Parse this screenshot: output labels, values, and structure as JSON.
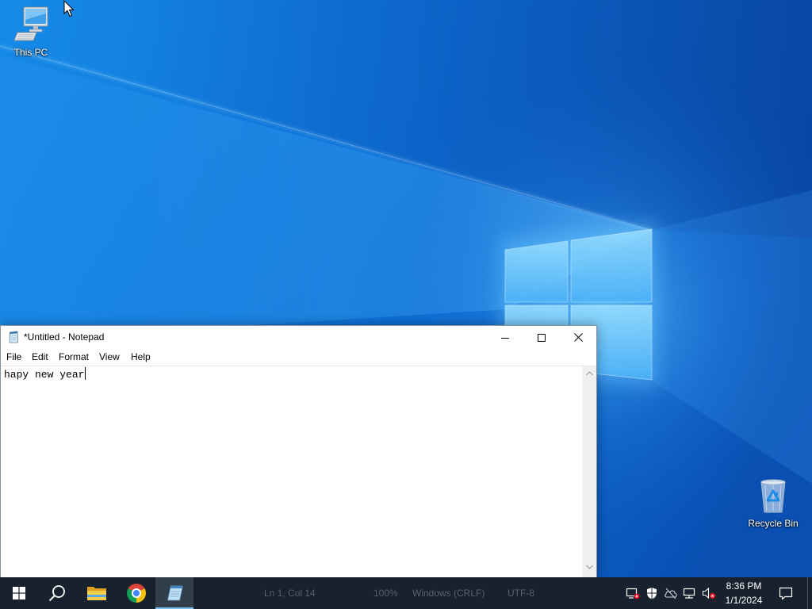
{
  "colors": {
    "desktop_blue": "#0f6fd4",
    "wallpaper_logo": "#7fd0ff",
    "taskbar": "#18222e",
    "taskbar_active": "#333e4b",
    "accent": "#7cc0f2",
    "notepad_border": "#8593a3"
  },
  "desktop": {
    "icons": [
      {
        "label": "This PC",
        "icon": "this-pc-icon"
      },
      {
        "label": "Recycle Bin",
        "icon": "recycle-bin-icon"
      }
    ]
  },
  "notepad": {
    "title": "*Untitled - Notepad",
    "icon": "notepad-icon",
    "controls": [
      "minimize-icon",
      "maximize-icon",
      "close-icon"
    ],
    "menu": [
      "File",
      "Edit",
      "Format",
      "View",
      "Help"
    ],
    "content": "hapy new year",
    "status": {
      "position": "Ln 1, Col 14",
      "zoom": "100%",
      "line_ending": "Windows (CRLF)",
      "encoding": "UTF-8"
    }
  },
  "taskbar": {
    "start_icon": "windows-logo-icon",
    "search_icon": "search-icon",
    "apps": [
      {
        "icon": "file-explorer-icon",
        "active": false
      },
      {
        "icon": "chrome-icon",
        "active": false
      },
      {
        "icon": "notepad-icon",
        "active": true
      }
    ],
    "tray": {
      "icons": [
        "security-alert-icon",
        "windows-security-icon",
        "onedrive-offline-icon",
        "network-icon",
        "volume-muted-icon"
      ],
      "time": "8:36 PM",
      "date": "1/1/2024",
      "notification_icon": "action-center-icon"
    }
  }
}
